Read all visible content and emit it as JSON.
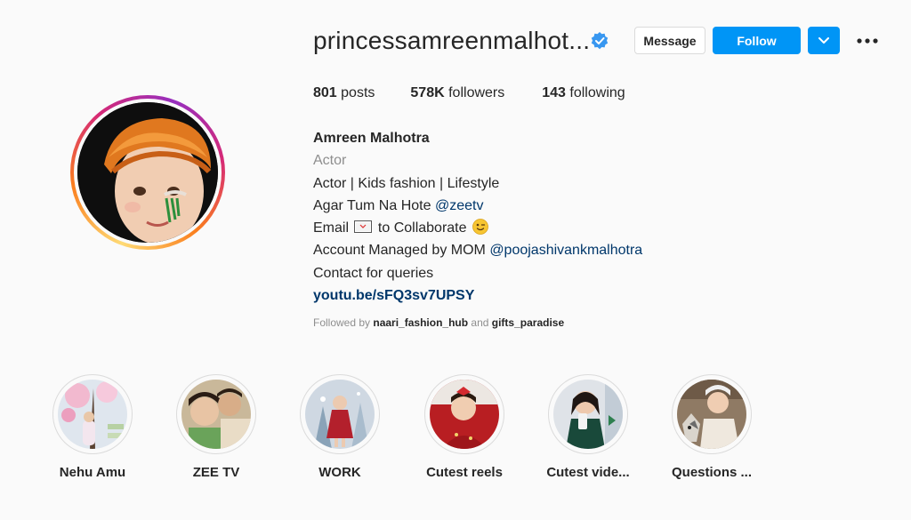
{
  "profile": {
    "username": "princessamreenmalhot...",
    "verified": true,
    "buttons": {
      "message": "Message",
      "follow": "Follow"
    },
    "icons": {
      "verified": "verified-badge-icon",
      "dropdown": "chevron-down-icon",
      "more": "more-options-icon"
    }
  },
  "stats": {
    "posts_count": "801",
    "posts_label": "posts",
    "followers_count": "578K",
    "followers_label": "followers",
    "following_count": "143",
    "following_label": "following"
  },
  "bio": {
    "name": "Amreen Malhotra",
    "category": "Actor",
    "line1": "Actor | Kids fashion | Lifestyle",
    "line2_text": "Agar Tum Na Hote ",
    "line2_mention": "@zeetv",
    "line3_pre": "Email ",
    "line3_post": " to Collaborate ",
    "line4_text": "Account Managed by MOM ",
    "line4_mention": "@poojashivankmalhotra",
    "line5": "Contact for queries",
    "link": "youtu.be/sFQ3sv7UPSY"
  },
  "followed_by": {
    "prefix": "Followed by ",
    "user1": "naari_fashion_hub",
    "conj": " and ",
    "user2": "gifts_paradise"
  },
  "highlights": [
    {
      "label": "Nehu Amu"
    },
    {
      "label": "ZEE TV"
    },
    {
      "label": "WORK"
    },
    {
      "label": "Cutest reels"
    },
    {
      "label": "Cutest vide..."
    },
    {
      "label": "Questions ..."
    }
  ],
  "colors": {
    "accent": "#0095f6",
    "link": "#00376b",
    "muted": "#8e8e8e",
    "verified": "#3897f0"
  }
}
